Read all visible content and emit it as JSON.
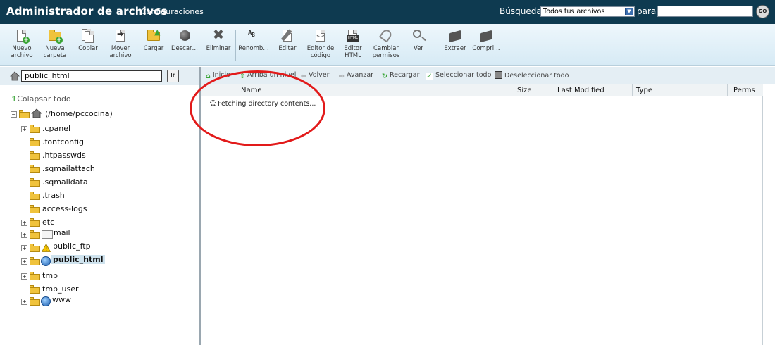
{
  "header": {
    "title": "Administrador de archivos",
    "settings_link": "Configuraciones",
    "search_label": "Búsqueda",
    "search_scope": "Todos tus archivos",
    "for_label": "para",
    "search_query": "",
    "go_label": "GO",
    "bg_color": "#0e3a50"
  },
  "toolbar": {
    "new_file": "Nuevo archivo",
    "new_folder": "Nueva carpeta",
    "copy": "Copiar",
    "move_file": "Mover archivo",
    "upload": "Cargar",
    "download": "Descar…",
    "delete": "Eliminar",
    "rename": "Renomb…",
    "edit": "Editar",
    "code_editor": "Editor de código",
    "html_editor": "Editor HTML",
    "change_permissions": "Cambiar permisos",
    "view": "Ver",
    "extract": "Extraer",
    "compress": "Compri…"
  },
  "left_panel": {
    "path_value": "public_html",
    "go_label": "Ir",
    "collapse_all": "Colapsar todo",
    "tree": {
      "root": "(/home/pccocina)",
      "cpanel": ".cpanel",
      "fontconfig": ".fontconfig",
      "htpasswds": ".htpasswds",
      "sqmailattach": ".sqmailattach",
      "sqmaildata": ".sqmaildata",
      "trash": ".trash",
      "access_logs": "access-logs",
      "etc": "etc",
      "mail": "mail",
      "public_ftp": "public_ftp",
      "public_html": "public_html",
      "tmp": "tmp",
      "tmp_user": "tmp_user",
      "www": "www"
    }
  },
  "nav_bar": {
    "home": "Inicio",
    "up_one_level": "Arriba un nivel",
    "back": "Volver",
    "forward": "Avanzar",
    "reload": "Recargar",
    "select_all": "Seleccionar todo",
    "deselect_all": "Deseleccionar todo"
  },
  "file_table": {
    "columns": {
      "name": "Name",
      "size": "Size",
      "last_modified": "Last Modified",
      "type": "Type",
      "perms": "Perms"
    },
    "status": "Fetching directory contents..."
  },
  "colors": {
    "accent_green": "#3aa536",
    "annotation_red": "#e21a1a",
    "selection": "#cfe3ee"
  }
}
